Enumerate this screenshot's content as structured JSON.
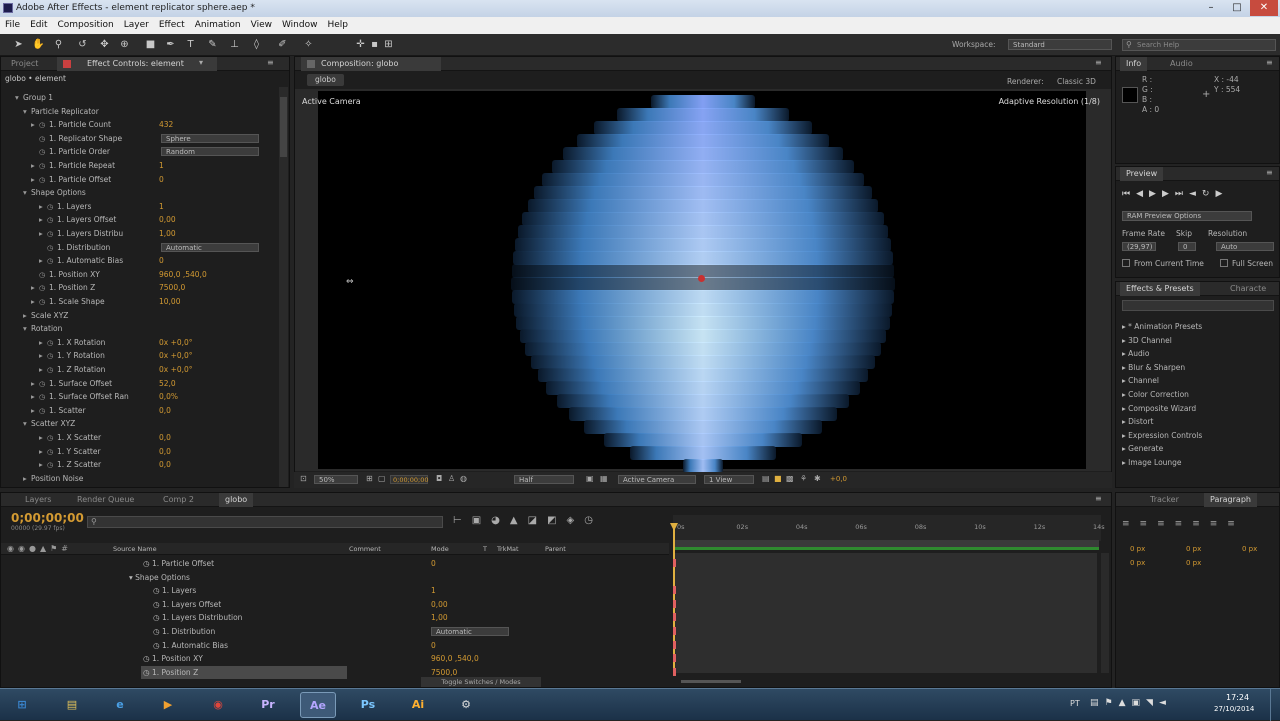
{
  "window": {
    "title": "Adobe After Effects - element replicator sphere.aep *"
  },
  "menu": [
    "File",
    "Edit",
    "Composition",
    "Layer",
    "Effect",
    "Animation",
    "View",
    "Window",
    "Help"
  ],
  "toolbar": {
    "workspace_label": "Workspace:",
    "workspace_value": "Standard",
    "search_placeholder": "Search Help"
  },
  "left_panel": {
    "tabs": [
      "Project",
      "Effect Controls: element"
    ],
    "breadcrumb": "globo • element",
    "rows": [
      {
        "indent": 1,
        "tri": "▾",
        "label": "Group 1",
        "value": "",
        "kind": "group"
      },
      {
        "indent": 2,
        "tri": "▾",
        "label": "Particle Replicator",
        "value": "",
        "kind": "group"
      },
      {
        "indent": 3,
        "tri": "▸",
        "label": "1. Particle Count",
        "value": "432",
        "kind": "val"
      },
      {
        "indent": 3,
        "tri": "",
        "label": "1. Replicator Shape",
        "value": "Sphere",
        "kind": "dd"
      },
      {
        "indent": 3,
        "tri": "",
        "label": "1. Particle Order",
        "value": "Random",
        "kind": "dd"
      },
      {
        "indent": 3,
        "tri": "▸",
        "label": "1. Particle Repeat",
        "value": "1",
        "kind": "val"
      },
      {
        "indent": 3,
        "tri": "▸",
        "label": "1. Particle Offset",
        "value": "0",
        "kind": "val"
      },
      {
        "indent": 2,
        "tri": "▾",
        "label": "Shape Options",
        "value": "",
        "kind": "group"
      },
      {
        "indent": 4,
        "tri": "▸",
        "label": "1. Layers",
        "value": "1",
        "kind": "val"
      },
      {
        "indent": 4,
        "tri": "▸",
        "label": "1. Layers Offset",
        "value": "0,00",
        "kind": "val"
      },
      {
        "indent": 4,
        "tri": "▸",
        "label": "1. Layers Distribu",
        "value": "1,00",
        "kind": "val"
      },
      {
        "indent": 4,
        "tri": "",
        "label": "1. Distribution",
        "value": "Automatic",
        "kind": "dd"
      },
      {
        "indent": 4,
        "tri": "▸",
        "label": "1. Automatic Bias",
        "value": "0",
        "kind": "val"
      },
      {
        "indent": 3,
        "tri": "",
        "label": "1. Position XY",
        "value": "960,0 ,540,0",
        "kind": "val"
      },
      {
        "indent": 3,
        "tri": "▸",
        "label": "1. Position Z",
        "value": "7500,0",
        "kind": "val"
      },
      {
        "indent": 3,
        "tri": "▸",
        "label": "1. Scale Shape",
        "value": "10,00",
        "kind": "val"
      },
      {
        "indent": 2,
        "tri": "▸",
        "label": "Scale XYZ",
        "value": "",
        "kind": "group"
      },
      {
        "indent": 2,
        "tri": "▾",
        "label": "Rotation",
        "value": "",
        "kind": "group"
      },
      {
        "indent": 4,
        "tri": "▸",
        "label": "1. X Rotation",
        "value": "0x +0,0°",
        "kind": "val"
      },
      {
        "indent": 4,
        "tri": "▸",
        "label": "1. Y Rotation",
        "value": "0x +0,0°",
        "kind": "val"
      },
      {
        "indent": 4,
        "tri": "▸",
        "label": "1. Z Rotation",
        "value": "0x +0,0°",
        "kind": "val"
      },
      {
        "indent": 3,
        "tri": "▸",
        "label": "1. Surface Offset",
        "value": "52,0",
        "kind": "val"
      },
      {
        "indent": 3,
        "tri": "▸",
        "label": "1. Surface Offset Ran",
        "value": "0,0%",
        "kind": "val"
      },
      {
        "indent": 3,
        "tri": "▸",
        "label": "1. Scatter",
        "value": "0,0",
        "kind": "val"
      },
      {
        "indent": 2,
        "tri": "▾",
        "label": "Scatter XYZ",
        "value": "",
        "kind": "group"
      },
      {
        "indent": 4,
        "tri": "▸",
        "label": "1. X Scatter",
        "value": "0,0",
        "kind": "val"
      },
      {
        "indent": 4,
        "tri": "▸",
        "label": "1. Y Scatter",
        "value": "0,0",
        "kind": "val"
      },
      {
        "indent": 4,
        "tri": "▸",
        "label": "1. Z Scatter",
        "value": "0,0",
        "kind": "val"
      },
      {
        "indent": 2,
        "tri": "▸",
        "label": "Position Noise",
        "value": "",
        "kind": "group"
      }
    ]
  },
  "comp": {
    "tab": "Composition: globo",
    "subtab": "globo",
    "renderer_label": "Renderer:",
    "renderer_value": "Classic 3D",
    "camera_label": "Active Camera",
    "adaptive_label": "Adaptive Resolution (1/8)",
    "footer": {
      "zoom": "50%",
      "timecode": "0;00;00;00",
      "resolution": "Half",
      "camera": "Active Camera",
      "views": "1 View",
      "exposure": "+0,0"
    }
  },
  "info_panel": {
    "tabs": [
      "Info",
      "Audio"
    ],
    "r": "R :",
    "g": "G :",
    "b": "B :",
    "a": "A : 0",
    "x": "X : -44",
    "y": "Y : 554"
  },
  "preview_panel": {
    "tab": "Preview",
    "ram_options": "RAM Preview Options",
    "frame_rate_label": "Frame Rate",
    "skip_label": "Skip",
    "resolution_label": "Resolution",
    "frame_rate_value": "(29,97)",
    "skip_value": "0",
    "resolution_value": "Auto",
    "from_current": "From Current Time",
    "full_screen": "Full Screen"
  },
  "effects_panel": {
    "tabs": [
      "Effects & Presets",
      "Characte"
    ],
    "items": [
      "* Animation Presets",
      "3D Channel",
      "Audio",
      "Blur & Sharpen",
      "Channel",
      "Color Correction",
      "Composite Wizard",
      "Distort",
      "Expression Controls",
      "Generate",
      "Image Lounge"
    ]
  },
  "paragraph_panel": {
    "tabs": [
      "Tracker",
      "Paragraph"
    ],
    "fields": [
      "0 px",
      "0 px",
      "0 px",
      "0 px",
      "0 px"
    ]
  },
  "timeline": {
    "tabs": [
      "Layers",
      "Render Queue",
      "Comp 2",
      "globo"
    ],
    "timecode": "0;00;00;00",
    "timecode_sub": "00000 (29.97 fps)",
    "search_placeholder": "",
    "columns": [
      "Source Name",
      "Comment",
      "Mode",
      "T",
      "TrkMat",
      "Parent"
    ],
    "ruler": [
      "0s",
      "02s",
      "04s",
      "06s",
      "08s",
      "10s",
      "12s",
      "14s"
    ],
    "rows": [
      {
        "indent": 1,
        "label": "1. Particle Offset",
        "value": "0"
      },
      {
        "indent": 0,
        "label": "Shape Options",
        "value": "",
        "group": true
      },
      {
        "indent": 2,
        "label": "1. Layers",
        "value": "1"
      },
      {
        "indent": 2,
        "label": "1. Layers Offset",
        "value": "0,00"
      },
      {
        "indent": 2,
        "label": "1. Layers Distribution",
        "value": "1,00"
      },
      {
        "indent": 2,
        "label": "1. Distribution",
        "value": "Automatic",
        "dd": true
      },
      {
        "indent": 2,
        "label": "1. Automatic Bias",
        "value": "0"
      },
      {
        "indent": 1,
        "label": "1. Position XY",
        "value": "960,0 ,540,0"
      },
      {
        "indent": 1,
        "label": "1. Position Z",
        "value": "7500,0",
        "selected": true
      }
    ],
    "footer_toggle": "Toggle Switches / Modes"
  },
  "taskbar": {
    "apps": [
      {
        "name": "start",
        "glyph": "⊞",
        "color": "#3a86d0"
      },
      {
        "name": "explorer",
        "glyph": "▤",
        "color": "#e2c25a"
      },
      {
        "name": "ie",
        "glyph": "e",
        "color": "#4aa0e6"
      },
      {
        "name": "media",
        "glyph": "▶",
        "color": "#f0a030"
      },
      {
        "name": "chrome",
        "glyph": "◉",
        "color": "#e0463b"
      },
      {
        "name": "premiere",
        "glyph": "Pr",
        "color": "#c8b4ff"
      },
      {
        "name": "aftereffects",
        "glyph": "Ae",
        "color": "#b4a6ff"
      },
      {
        "name": "photoshop",
        "glyph": "Ps",
        "color": "#7cc7ff"
      },
      {
        "name": "illustrator",
        "glyph": "Ai",
        "color": "#ffb030"
      },
      {
        "name": "other",
        "glyph": "⚙",
        "color": "#dddddd"
      }
    ],
    "lang": "PT",
    "time": "17:24",
    "date": "27/10/2014"
  },
  "colors": {
    "accent": "#d39a32",
    "panel": "#1e1e1e",
    "sphere": "#5aa2e8"
  }
}
